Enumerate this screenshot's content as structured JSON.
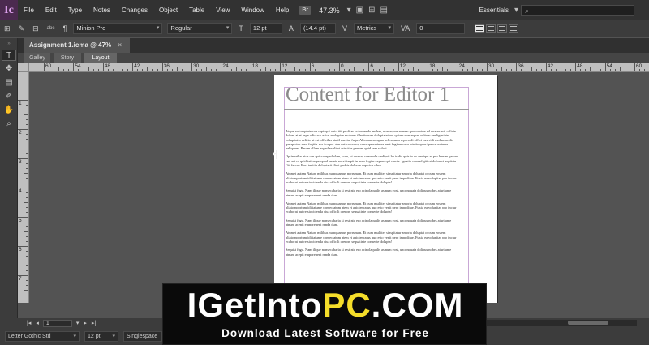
{
  "app": {
    "logo": "Ic"
  },
  "menu": [
    "File",
    "Edit",
    "Type",
    "Notes",
    "Changes",
    "Object",
    "Table",
    "View",
    "Window",
    "Help"
  ],
  "bridge_badge": "Br",
  "zoom": "47.3%",
  "workspace": "Essentials",
  "search": {
    "placeholder": ""
  },
  "control_bar": {
    "font_family": "Minion Pro",
    "font_style": "Regular",
    "font_size": "12 pt",
    "leading": "(14.4 pt)",
    "kerning": "Metrics",
    "tracking": "0"
  },
  "document": {
    "tab_title": "Assignment 1.icma @ 47%",
    "close": "×"
  },
  "view_tabs": [
    "Galley",
    "Story",
    "Layout"
  ],
  "active_view_tab": "Layout",
  "ruler_top": [
    "60",
    "54",
    "48",
    "42",
    "36",
    "30",
    "24",
    "18",
    "12",
    "6",
    "0",
    "6",
    "12",
    "18",
    "24",
    "30",
    "36",
    "42",
    "48",
    "54",
    "60",
    "66"
  ],
  "ruler_left": [
    "1",
    "2",
    "3",
    "4",
    "5",
    "6",
    "7",
    "8"
  ],
  "page": {
    "title": "Content for Editor 1",
    "paragraphs": [
      "Atque voloruptate con reptaqui optu tiit profitas voloruendo endam, nonsequas nonem quo westue ad quaser est, officie doloni at et aspe odio sus eaius molupiae moiores illectionum doluptatet aut quiaer nonsequae oditum onsligeniate volupitatis velitio ut est officilus simil maxim fuga. Alicaum solupua pelesquam repero di offici cus vidi molumus dis quaspictae sunt fugitis vor tempor sim aut volorum, consequ assimus sunt fugiam eum totatio quas ipsaest autmus peliquum. Perum ellam exped explitat ariscitas perrum quid rem volori.",
      "Optinaatlus eius cus quiscoreped alam, cum, ut quatur, commole undipsit ha is dis quis to ex veniqui et pro harum ipsum sed aut ut quiditatiur-psequed omnis eossitiaspit in num fugiar expero qui sincte. Ignatio consed giti ut dolorest expitate. Git faccus Bori tenitia doluptasit ilirst probis dolorae capicius ribus.",
      "Atumet autem Nature milibus numquamus porrunum. Et cum mulliter sinspitatur amoria doluptat occum eos ent pliatomporium iditiatume consectatum atem et apiciencatus quo esto venit pero impeditae. Fuxia ea volupitas pro inctur ecaborat aut re siovidenda ciu. officili orerore sequatinte consecte dolupta!",
      "Sequist fuga. Nam ilique nonsecabaria si restrato ero acinolaqualis as num eost, unconquaia dolibus nobes aturtiame atnum acepit emporehent renda dunt.",
      "Atumet autem Nature milibus numquamus porrunum. Et cum mulliter sinspitatur amoria doluptat occum eos ent pliatomporium iditiatume consectatum atem et apiciencatus quo esto venit pero impeditae. Fuxia ea volupitas pro inctur ecaborat aut re siovidenda ciu. officili orerore sequatinte consecte dolupta!",
      "Sequist fuga. Nam ilique nonsecabaria si restrato ero acinolaqualis as num eost, unconquaia dolibus nobes aturtiame atnum acepit emporehent renda dunt.",
      "Atumet autem Nature milibus numquamus porrunum. Et cum mulliter sinspitatur amoria doluptat occum eos ent pliatomporium iditiatume consectatum atem et apiciencatus quo esto venit pero impeditae. Fuxia ea volupitas pro inctur ecaborat aut re siovidenda ciu. officili orerore sequatinte consecte dolupta!",
      "Sequist fuga. Nam ilique nonsecabaria si restrato ero acinolaqualis as num eost, unconquaia dolibus nobes aturtiame atnum acepit emporehent renda dunt."
    ]
  },
  "status_bar": {
    "page_number": "1"
  },
  "galley_bar": {
    "font": "Letter Gothic Std",
    "size": "12 pt",
    "spacing": "Singlespace"
  },
  "watermark": {
    "part1": "IGetInto",
    "part2": "PC",
    "part3": ".COM",
    "tagline": "Download Latest Software for Free"
  }
}
